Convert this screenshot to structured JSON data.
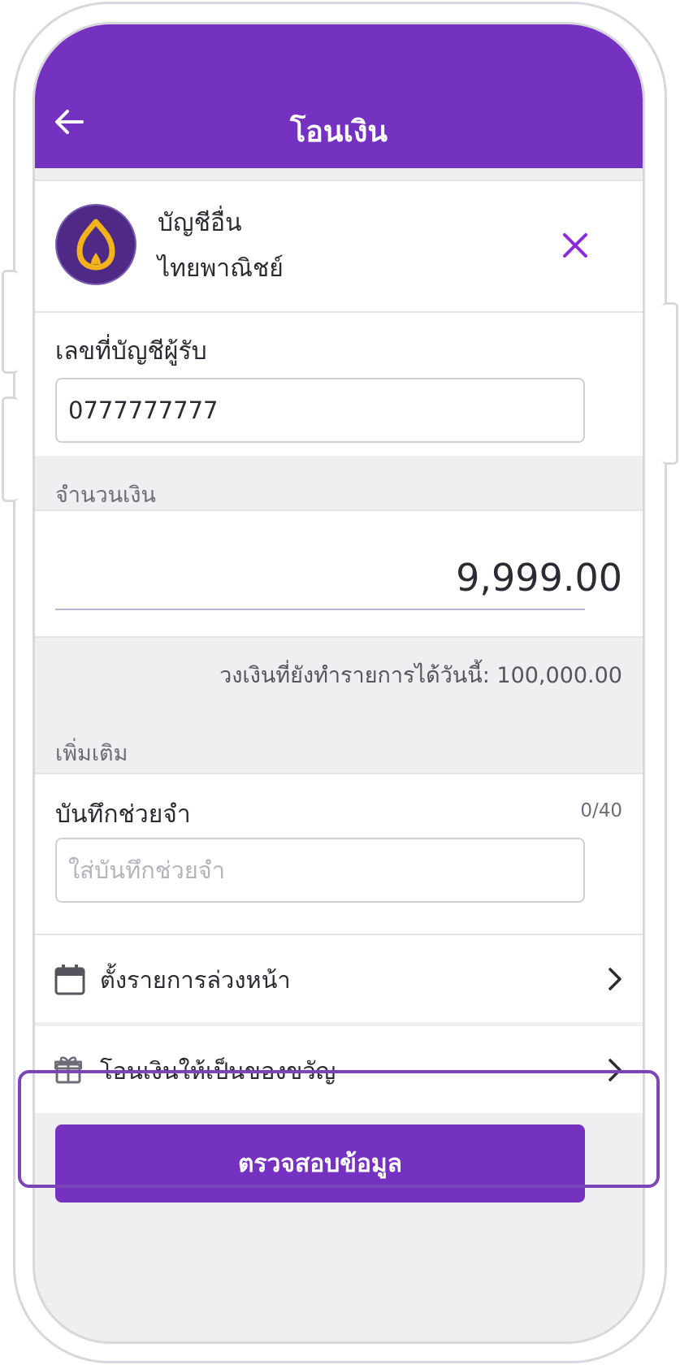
{
  "header": {
    "title": "โอนเงิน",
    "back_icon": "arrow-left-icon"
  },
  "recipient": {
    "bank_logo_icon": "scb-bank-logo-icon",
    "account_type": "บัญชีอื่น",
    "bank_name": "ไทยพาณิชย์",
    "remove_icon": "close-icon"
  },
  "account_number": {
    "label": "เลขที่บัญชีผู้รับ",
    "value": "0777777777"
  },
  "amount": {
    "section_label": "จำนวนเงิน",
    "value": "9,999.00",
    "remaining_limit": "วงเงินที่ยังทำรายการได้วันนี้: 100,000.00"
  },
  "additional": {
    "section_label": "เพิ่มเติม",
    "memo_label": "บันทึกช่วยจำ",
    "memo_counter": "0/40",
    "memo_placeholder": "ใส่บันทึกช่วยจำ",
    "memo_value": ""
  },
  "options": [
    {
      "label": "ตั้งรายการล่วงหน้า",
      "icon": "calendar-icon"
    },
    {
      "label": "โอนเงินให้เป็นของขวัญ",
      "icon": "gift-icon"
    }
  ],
  "submit_label": "ตรวจสอบข้อมูล",
  "colors": {
    "brand_purple": "#7532c0",
    "logo_gold": "#f2b21b",
    "highlight_border": "#7c44b6"
  }
}
